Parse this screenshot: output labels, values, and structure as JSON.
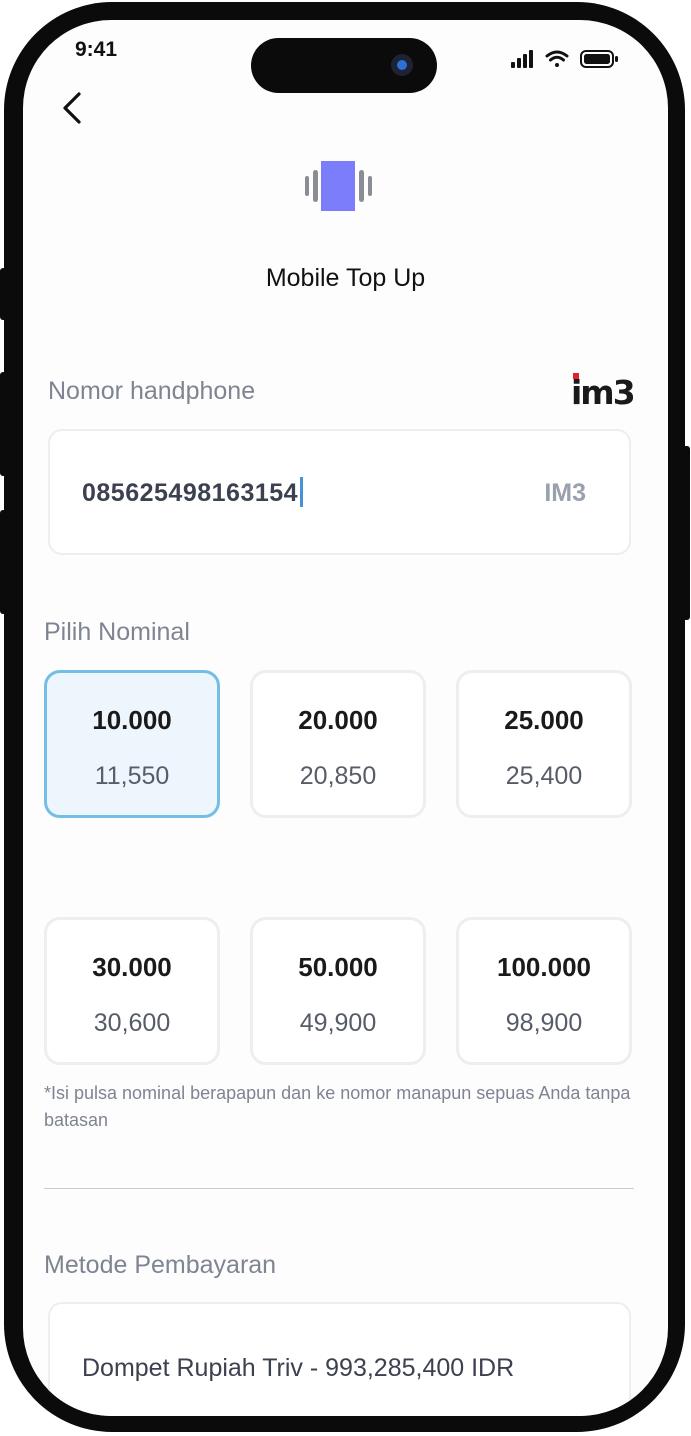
{
  "status_bar": {
    "time": "9:41"
  },
  "header": {
    "title": "Mobile Top Up"
  },
  "phone": {
    "label": "Nomor handphone",
    "brand_logo_text": "im3",
    "value": "085625498163154",
    "operator": "IM3"
  },
  "nominal": {
    "label": "Pilih Nominal",
    "selected_index": 0,
    "options": [
      {
        "amount": "10.000",
        "price": "11,550"
      },
      {
        "amount": "20.000",
        "price": "20,850"
      },
      {
        "amount": "25.000",
        "price": "25,400"
      },
      {
        "amount": "30.000",
        "price": "30,600"
      },
      {
        "amount": "50.000",
        "price": "49,900"
      },
      {
        "amount": "100.000",
        "price": "98,900"
      }
    ],
    "note": "*Isi pulsa nominal berapapun dan ke nomor manapun sepuas Anda tanpa batasan"
  },
  "payment": {
    "label": "Metode Pembayaran",
    "method": "Dompet Rupiah Triv - 993,285,400 IDR"
  },
  "colors": {
    "accent": "#74bde4",
    "logo_purple": "#7b7dfa",
    "brand_red": "#e0202c"
  },
  "icons": [
    "back-chevron-icon",
    "signal-icon",
    "wifi-icon",
    "battery-icon",
    "vibrate-phone-icon"
  ]
}
